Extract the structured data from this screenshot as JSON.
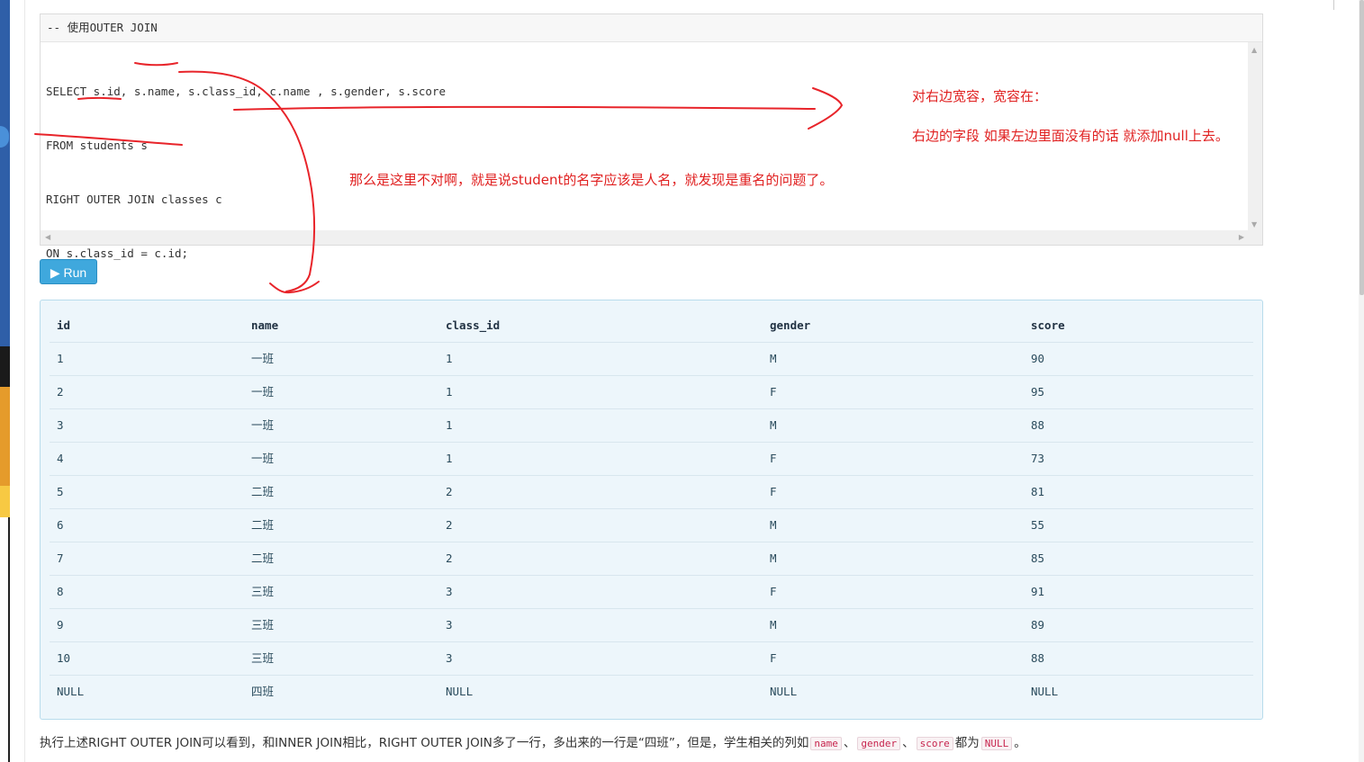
{
  "editor": {
    "header": "-- 使用OUTER JOIN",
    "lines": [
      "SELECT s.id, s.name, s.class_id, c.name , s.gender, s.score",
      "FROM students s",
      "RIGHT OUTER JOIN classes c",
      "ON s.class_id = c.id;"
    ]
  },
  "run_button": {
    "label": "Run"
  },
  "result": {
    "columns": [
      "id",
      "name",
      "class_id",
      "gender",
      "score"
    ],
    "rows": [
      [
        "1",
        "一班",
        "1",
        "M",
        "90"
      ],
      [
        "2",
        "一班",
        "1",
        "F",
        "95"
      ],
      [
        "3",
        "一班",
        "1",
        "M",
        "88"
      ],
      [
        "4",
        "一班",
        "1",
        "F",
        "73"
      ],
      [
        "5",
        "二班",
        "2",
        "F",
        "81"
      ],
      [
        "6",
        "二班",
        "2",
        "M",
        "55"
      ],
      [
        "7",
        "二班",
        "2",
        "M",
        "85"
      ],
      [
        "8",
        "三班",
        "3",
        "F",
        "91"
      ],
      [
        "9",
        "三班",
        "3",
        "M",
        "89"
      ],
      [
        "10",
        "三班",
        "3",
        "F",
        "88"
      ],
      [
        "NULL",
        "四班",
        "NULL",
        "NULL",
        "NULL"
      ]
    ]
  },
  "annotations": {
    "right_note_1": "对右边宽容，宽容在：",
    "right_note_2": "右边的字段  如果左边里面没有的话 就添加null上去。",
    "middle_note": "那么是这里不对啊，就是说student的名字应该是人名，就发现是重名的问题了。"
  },
  "footer": {
    "text_1": "执行上述RIGHT OUTER JOIN可以看到，和INNER JOIN相比，RIGHT OUTER JOIN多了一行，多出来的一行是“四班”，但是，学生相关的列如",
    "code_1": "name",
    "sep_1": "、",
    "code_2": "gender",
    "sep_2": "、",
    "code_3": "score",
    "text_2": "都为",
    "code_4": "NULL",
    "text_3": "。"
  },
  "colors": {
    "annotation_red": "#e02020",
    "run_button": "#3fa8dd",
    "result_bg": "#edf6fb"
  }
}
